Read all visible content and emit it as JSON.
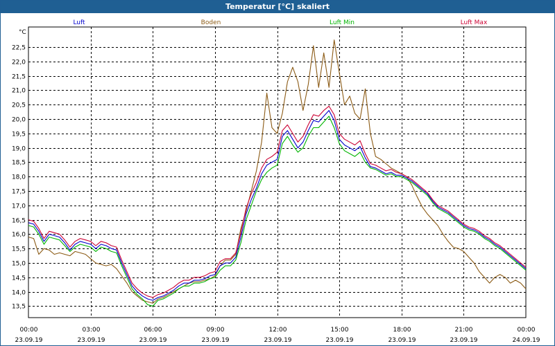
{
  "window": {
    "title": "Temperatur [°C] skaliert"
  },
  "colors": {
    "luft": "#0000cc",
    "boden": "#8b5a14",
    "luft_min": "#00b400",
    "luft_max": "#cc0033",
    "grid": "#000000",
    "titlebar": "#1f5f93"
  },
  "chart_data": {
    "type": "line",
    "title": "Temperatur [°C] skaliert",
    "ylabel": "°C",
    "ylim": [
      13.1,
      23.2
    ],
    "xlim": [
      0,
      24
    ],
    "grid": true,
    "legend_placement": "top",
    "y_ticks": [
      "13,5",
      "14,0",
      "14,5",
      "15,0",
      "15,5",
      "16,0",
      "16,5",
      "17,0",
      "17,5",
      "18,0",
      "18,5",
      "19,0",
      "19,5",
      "20,0",
      "20,5",
      "21,0",
      "21,5",
      "22,0",
      "22,5"
    ],
    "x_ticks": [
      {
        "time": "00:00",
        "date": "23.09.19"
      },
      {
        "time": "03:00",
        "date": "23.09.19"
      },
      {
        "time": "06:00",
        "date": "23.09.19"
      },
      {
        "time": "09:00",
        "date": "23.09.19"
      },
      {
        "time": "12:00",
        "date": "23.09.19"
      },
      {
        "time": "15:00",
        "date": "23.09.19"
      },
      {
        "time": "18:00",
        "date": "23.09.19"
      },
      {
        "time": "21:00",
        "date": "23.09.19"
      },
      {
        "time": "00:00",
        "date": "24.09.19"
      }
    ],
    "x_hours": [
      0,
      0.25,
      0.5,
      0.75,
      1,
      1.25,
      1.5,
      1.75,
      2,
      2.25,
      2.5,
      2.75,
      3,
      3.25,
      3.5,
      3.75,
      4,
      4.25,
      4.5,
      4.75,
      5,
      5.25,
      5.5,
      5.75,
      6,
      6.25,
      6.5,
      6.75,
      7,
      7.25,
      7.5,
      7.75,
      8,
      8.25,
      8.5,
      8.75,
      9,
      9.25,
      9.5,
      9.75,
      10,
      10.25,
      10.5,
      10.75,
      11,
      11.25,
      11.5,
      11.75,
      12,
      12.25,
      12.5,
      12.75,
      13,
      13.25,
      13.5,
      13.75,
      14,
      14.25,
      14.5,
      14.75,
      15,
      15.25,
      15.5,
      15.75,
      16,
      16.25,
      16.5,
      16.75,
      17,
      17.25,
      17.5,
      17.75,
      18,
      18.25,
      18.5,
      18.75,
      19,
      19.25,
      19.5,
      19.75,
      20,
      20.25,
      20.5,
      20.75,
      21,
      21.25,
      21.5,
      21.75,
      22,
      22.25,
      22.5,
      22.75,
      23,
      23.25,
      23.5,
      23.75,
      24
    ],
    "series": [
      {
        "name": "Luft",
        "color": "#0000cc",
        "values": [
          16.4,
          16.35,
          16.1,
          15.75,
          16.0,
          15.95,
          15.9,
          15.7,
          15.45,
          15.65,
          15.75,
          15.7,
          15.65,
          15.5,
          15.65,
          15.6,
          15.5,
          15.45,
          15.0,
          14.6,
          14.2,
          14.0,
          13.85,
          13.75,
          13.7,
          13.8,
          13.85,
          13.95,
          14.05,
          14.2,
          14.3,
          14.3,
          14.4,
          14.4,
          14.45,
          14.55,
          14.6,
          14.9,
          15.0,
          15.0,
          15.2,
          15.9,
          16.7,
          17.2,
          17.6,
          18.1,
          18.4,
          18.5,
          18.6,
          19.4,
          19.6,
          19.3,
          19.0,
          19.2,
          19.6,
          19.95,
          19.9,
          20.1,
          20.3,
          19.95,
          19.3,
          19.1,
          19.0,
          18.9,
          19.05,
          18.65,
          18.35,
          18.3,
          18.2,
          18.1,
          18.15,
          18.05,
          18.05,
          17.95,
          17.85,
          17.7,
          17.55,
          17.4,
          17.15,
          16.95,
          16.85,
          16.75,
          16.6,
          16.45,
          16.3,
          16.2,
          16.15,
          16.05,
          15.9,
          15.8,
          15.65,
          15.55,
          15.4,
          15.25,
          15.1,
          14.95,
          14.8
        ]
      },
      {
        "name": "Boden",
        "color": "#8b5a14",
        "values": [
          15.9,
          15.85,
          15.3,
          15.5,
          15.45,
          15.3,
          15.35,
          15.3,
          15.25,
          15.4,
          15.35,
          15.3,
          15.15,
          15.0,
          14.95,
          14.9,
          14.95,
          14.8,
          14.55,
          14.3,
          14.0,
          13.85,
          13.7,
          13.65,
          13.6,
          13.75,
          13.8,
          13.9,
          14.0,
          14.1,
          14.2,
          14.3,
          14.35,
          14.35,
          14.4,
          14.45,
          14.55,
          14.9,
          15.1,
          15.1,
          15.3,
          16.2,
          16.8,
          17.5,
          18.2,
          19.2,
          20.9,
          19.7,
          19.5,
          20.2,
          21.3,
          21.8,
          21.3,
          20.3,
          21.2,
          22.55,
          21.1,
          22.3,
          21.1,
          22.75,
          21.6,
          20.5,
          20.8,
          20.2,
          20.0,
          21.05,
          19.5,
          18.7,
          18.6,
          18.45,
          18.3,
          18.2,
          18.1,
          18.0,
          17.7,
          17.3,
          16.95,
          16.7,
          16.5,
          16.3,
          16.0,
          15.75,
          15.55,
          15.5,
          15.4,
          15.2,
          15.0,
          14.7,
          14.5,
          14.3,
          14.5,
          14.6,
          14.5,
          14.3,
          14.4,
          14.3,
          14.1
        ]
      },
      {
        "name": "Luft Min",
        "color": "#00b400",
        "values": [
          16.3,
          16.25,
          16.0,
          15.65,
          15.9,
          15.85,
          15.8,
          15.6,
          15.4,
          15.55,
          15.65,
          15.6,
          15.55,
          15.4,
          15.55,
          15.5,
          15.4,
          15.35,
          14.9,
          14.5,
          14.1,
          13.9,
          13.75,
          13.55,
          13.5,
          13.7,
          13.75,
          13.85,
          13.95,
          14.1,
          14.2,
          14.2,
          14.3,
          14.3,
          14.35,
          14.45,
          14.5,
          14.75,
          14.9,
          14.9,
          15.1,
          15.7,
          16.5,
          17.0,
          17.5,
          17.9,
          18.15,
          18.3,
          18.4,
          19.15,
          19.4,
          19.1,
          18.85,
          19.0,
          19.4,
          19.7,
          19.7,
          19.9,
          20.1,
          19.7,
          19.15,
          18.9,
          18.8,
          18.7,
          18.85,
          18.5,
          18.3,
          18.25,
          18.15,
          18.05,
          18.1,
          18.0,
          18.0,
          17.9,
          17.8,
          17.65,
          17.5,
          17.35,
          17.1,
          16.9,
          16.8,
          16.7,
          16.55,
          16.4,
          16.25,
          16.15,
          16.1,
          16.0,
          15.85,
          15.75,
          15.6,
          15.5,
          15.35,
          15.2,
          15.05,
          14.9,
          14.75
        ]
      },
      {
        "name": "Luft Max",
        "color": "#cc0033",
        "values": [
          16.5,
          16.45,
          16.2,
          15.85,
          16.1,
          16.05,
          16.0,
          15.8,
          15.55,
          15.75,
          15.85,
          15.8,
          15.75,
          15.6,
          15.75,
          15.7,
          15.6,
          15.55,
          15.1,
          14.7,
          14.3,
          14.1,
          13.95,
          13.85,
          13.8,
          13.9,
          13.95,
          14.05,
          14.15,
          14.3,
          14.4,
          14.4,
          14.5,
          14.5,
          14.55,
          14.65,
          14.7,
          15.05,
          15.15,
          15.15,
          15.35,
          16.05,
          16.9,
          17.4,
          17.8,
          18.3,
          18.6,
          18.7,
          18.85,
          19.6,
          19.8,
          19.5,
          19.2,
          19.4,
          19.8,
          20.15,
          20.1,
          20.3,
          20.45,
          20.15,
          19.5,
          19.3,
          19.2,
          19.1,
          19.25,
          18.8,
          18.45,
          18.4,
          18.3,
          18.2,
          18.25,
          18.15,
          18.1,
          18.0,
          17.9,
          17.75,
          17.6,
          17.45,
          17.2,
          17.0,
          16.9,
          16.8,
          16.65,
          16.5,
          16.35,
          16.25,
          16.2,
          16.1,
          15.95,
          15.85,
          15.7,
          15.6,
          15.45,
          15.3,
          15.15,
          15.0,
          14.85
        ]
      }
    ]
  }
}
